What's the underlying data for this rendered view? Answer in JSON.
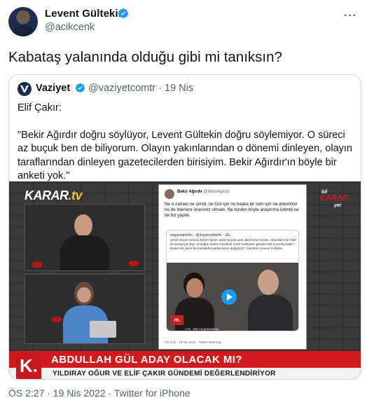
{
  "author": {
    "name": "Levent Gültekin",
    "handle": "@acikcenk"
  },
  "tweet_text": "Kabataş yalanında olduğu gibi mi tanıksın?",
  "quoted": {
    "name": "Vaziyet",
    "handle": "@vaziyetcomtr",
    "separator": "·",
    "date": "19 Nis",
    "line1": "Elif Çakır:",
    "line2": "\"Bekir Ağırdır doğru söylüyor, Levent Gültekin doğru söylemiyor. O süreci az buçuk ben de biliyorum. Olayın yakınlarından o dönemi dinleyen, olayın taraflarından dinleyen gazetecilerden birisiyim. Bekir Ağırdır'ın böyle bir anketi yok.\""
  },
  "media": {
    "channel_logo": "KARAR",
    "channel_logo_suffix": ".tv",
    "program_logo_top": "bil",
    "program_logo_mid": "KARAR",
    "program_logo_bottom": "yer",
    "k_logo": "K.",
    "headline": "ABDULLAH GÜL ADAY OLACAK MI?",
    "subline": "YILDIRAY OĞUR VE ELİF ÇAKIR GÜNDEMİ DEĞERLENDİRİYOR",
    "embedded_tweet": {
      "name": "Bekir Ağırdır",
      "handle": "@BekirAgirdir",
      "text": "Ne o zaman ne şimdi, ne Gül için ne başka bir isim için ne anketimiz ne de liderlere önerimiz olmadı. Ne bizden böyle araştırma istendi ne de biz yaptık.",
      "quote_head": "dogansabtkifix · @dogansabtkifix · 18s",
      "quote_text": "(2018 Seçim Süreci) Bekir Ağırdır anket koydu parti liderlerinin önüne. Abdullah Gül %50 ile kazanıyor diye. Erdoğan neden Abdullah Gül'e helikopter göndermek zorunda kaldı? Neden bir gece bir muhalefet partisi karar değiştirdi? -Gazeteci Levent Gültekin",
      "badge": "m.",
      "views": "1:05 · 336,1 B görüntüleme",
      "footer": "ÖS 3:20 · 19 Nis 2022 · Twitter Web App"
    }
  },
  "footer": {
    "timestamp": "ÖS 2:27 · 19 Nis 2022 · Twitter for iPhone"
  },
  "colors": {
    "verified": "#1d9bf0",
    "muted": "#536471",
    "border": "#cfd9de",
    "banner_red": "#d2191e"
  },
  "icons": [
    "verified-badge-icon",
    "more-icon",
    "play-icon"
  ]
}
